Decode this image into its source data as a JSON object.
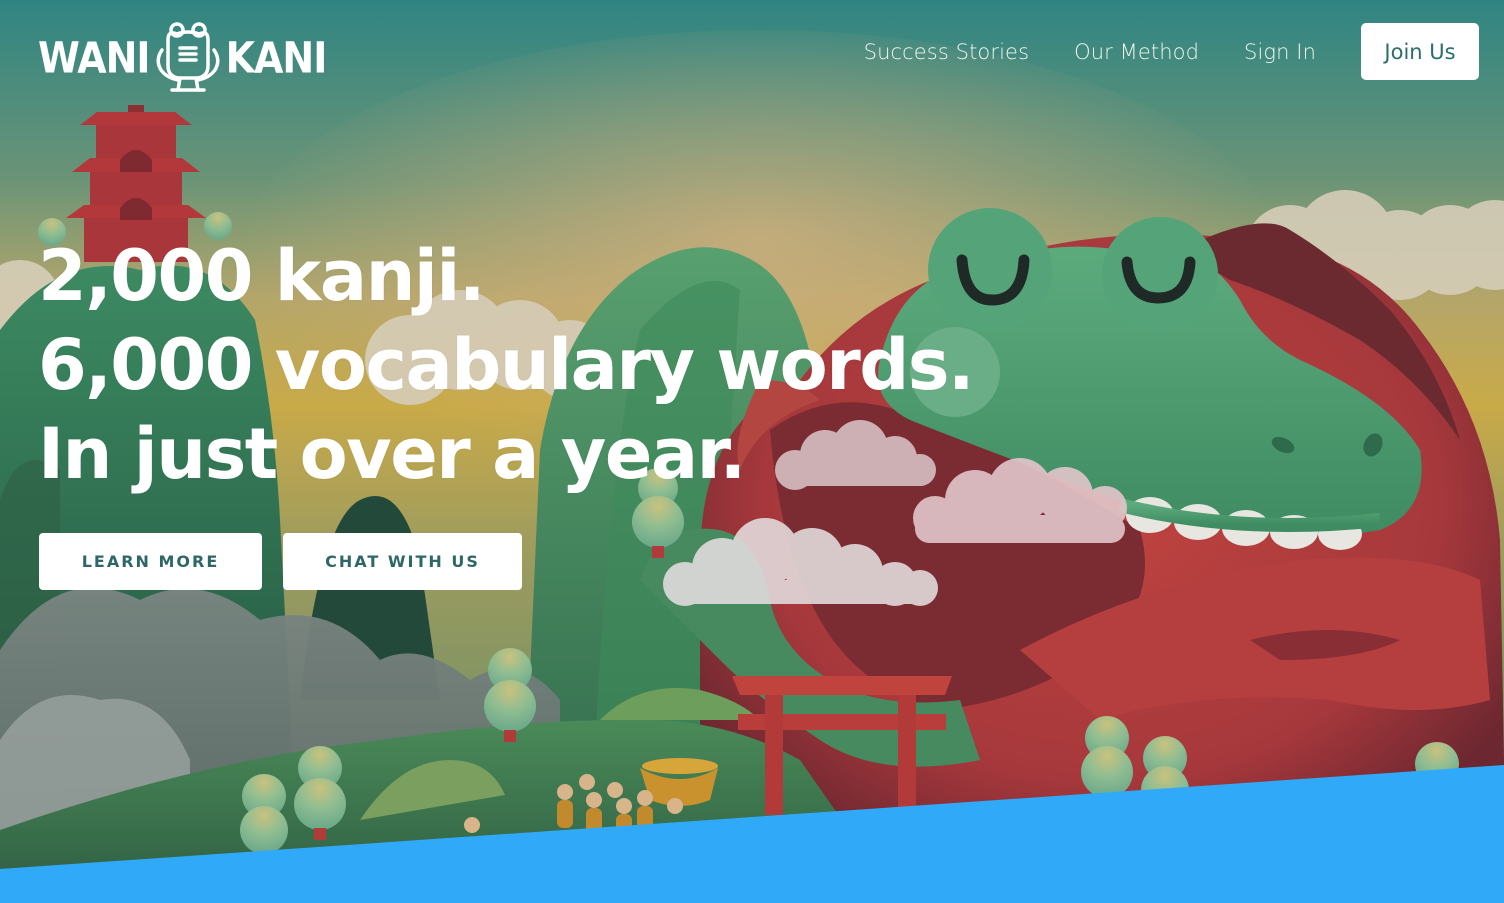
{
  "logo": {
    "left_word": "WANI",
    "right_word": "KANI",
    "mark_icon": "crabigator-mascot-icon"
  },
  "nav": {
    "items": [
      {
        "label": "Success Stories"
      },
      {
        "label": "Our Method"
      },
      {
        "label": "Sign In"
      }
    ],
    "join_label": "Join Us"
  },
  "hero": {
    "lines": [
      "2,000 kanji.",
      "6,000 vocabulary words.",
      "In just over a year."
    ]
  },
  "buttons": {
    "learn_more": "LEARN MORE",
    "chat": "CHAT WITH US"
  },
  "colors": {
    "accent_blue": "#30aaf8",
    "button_text": "#2f6766",
    "dragon_red": "#b23b3d",
    "dragon_green": "#4e9a72"
  }
}
